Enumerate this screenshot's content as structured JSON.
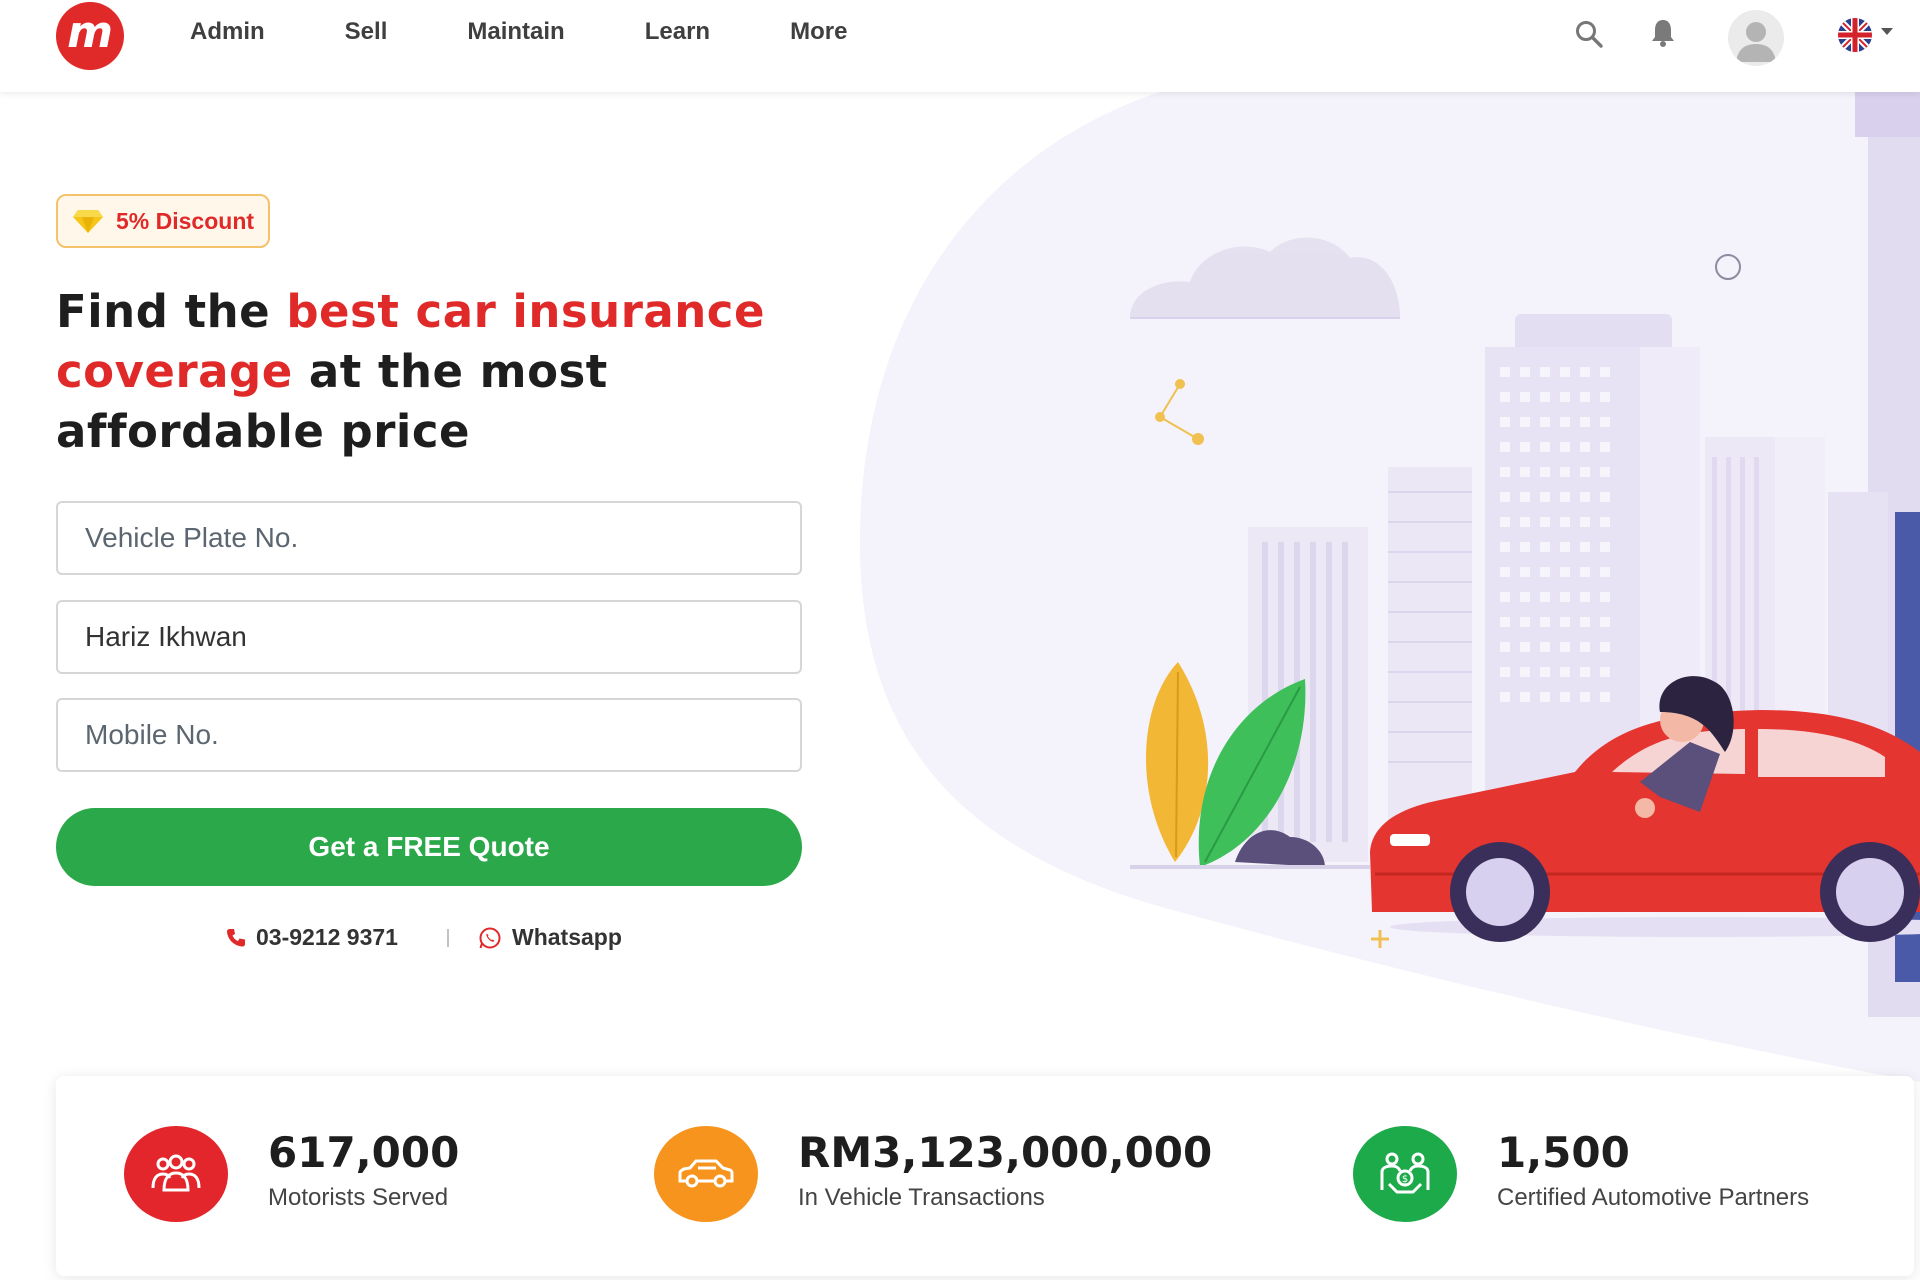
{
  "header": {
    "logo_letter": "m",
    "nav": [
      {
        "label": "Admin"
      },
      {
        "label": "Sell"
      },
      {
        "label": "Maintain"
      },
      {
        "label": "Learn"
      },
      {
        "label": "More"
      }
    ],
    "icons": [
      "search-icon",
      "bell-icon",
      "user-avatar-icon",
      "uk-flag-icon",
      "caret-down-icon"
    ]
  },
  "hero": {
    "badge": "5% Discount",
    "headline": {
      "part1": "Find the ",
      "highlight": "best car insurance coverage",
      "part2": " at the most affordable price"
    },
    "form": {
      "plate_placeholder": "Vehicle Plate No.",
      "name_value": "Hariz Ikhwan",
      "mobile_placeholder": "Mobile No."
    },
    "cta": "Get a FREE Quote",
    "phone": "03-9212 9371",
    "whatsapp": "Whatsapp"
  },
  "chart_data": {
    "type": "table",
    "stats": [
      {
        "value": "617,000",
        "label": "Motorists Served"
      },
      {
        "value": "RM3,123,000,000",
        "label": "In Vehicle Transactions"
      },
      {
        "value": "1,500",
        "label": "Certified Automotive Partners"
      }
    ]
  },
  "colors": {
    "brand_red": "#e02a2a",
    "cta_green": "#2aa84a",
    "stat_red": "#e3262b",
    "stat_orange": "#f7941d",
    "stat_green": "#1daa4b",
    "badge_border": "#f4c26b"
  }
}
